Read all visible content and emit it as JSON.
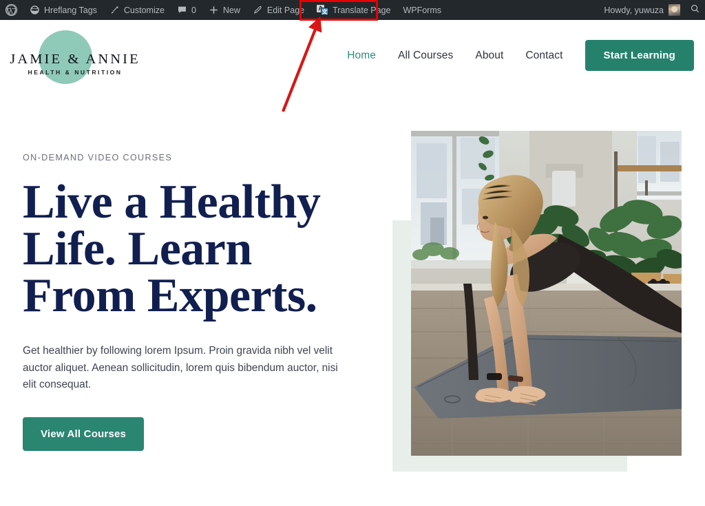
{
  "adminbar": {
    "items": [
      {
        "icon": "wordpress-logo-icon",
        "label": ""
      },
      {
        "icon": "hreflang-icon",
        "label": "Hreflang Tags"
      },
      {
        "icon": "paintbrush-icon",
        "label": "Customize"
      },
      {
        "icon": "comment-icon",
        "label": "0"
      },
      {
        "icon": "plus-icon",
        "label": "New"
      },
      {
        "icon": "pencil-icon",
        "label": "Edit Page"
      },
      {
        "icon": "translate-icon",
        "label": "Translate Page"
      },
      {
        "icon": "",
        "label": "WPForms"
      }
    ],
    "hreflang_label": "Hreflang Tags",
    "customize_label": "Customize",
    "comment_count": "0",
    "new_label": "New",
    "edit_page_label": "Edit Page",
    "translate_page_label": "Translate Page",
    "wpforms_label": "WPForms",
    "howdy_label": "Howdy, yuwuza",
    "search_icon": "search-icon",
    "translate_icon_primary": "A",
    "translate_icon_secondary": "文",
    "highlight_color": "#e60000"
  },
  "header": {
    "logo": {
      "name": "JAMIE & ANNIE",
      "tagline": "HEALTH & NUTRITION",
      "circle_color": "#8fc9b8"
    },
    "nav": [
      {
        "label": "Home",
        "active": true
      },
      {
        "label": "All Courses",
        "active": false
      },
      {
        "label": "About",
        "active": false
      },
      {
        "label": "Contact",
        "active": false
      }
    ],
    "nav_items": {
      "home": "Home",
      "all_courses": "All Courses",
      "about": "About",
      "contact": "Contact"
    },
    "cta_label": "Start Learning",
    "cta_color": "#25816c"
  },
  "hero": {
    "eyebrow": "ON-DEMAND VIDEO COURSES",
    "title_line1": "Live a Healthy",
    "title_line2": "Life. Learn",
    "title_line3": "From Experts.",
    "title_color": "#111f50",
    "paragraph": "Get healthier by following lorem Ipsum. Proin gravida nibh vel velit auctor aliquet. Aenean sollicitudin, lorem quis bibendum auctor, nisi elit consequat.",
    "button_label": "View All Courses",
    "button_color": "#2a8571",
    "image_alt": "woman doing a yoga side plank on a mat in a plant filled studio",
    "decorative_box_color": "#e8efeb"
  }
}
